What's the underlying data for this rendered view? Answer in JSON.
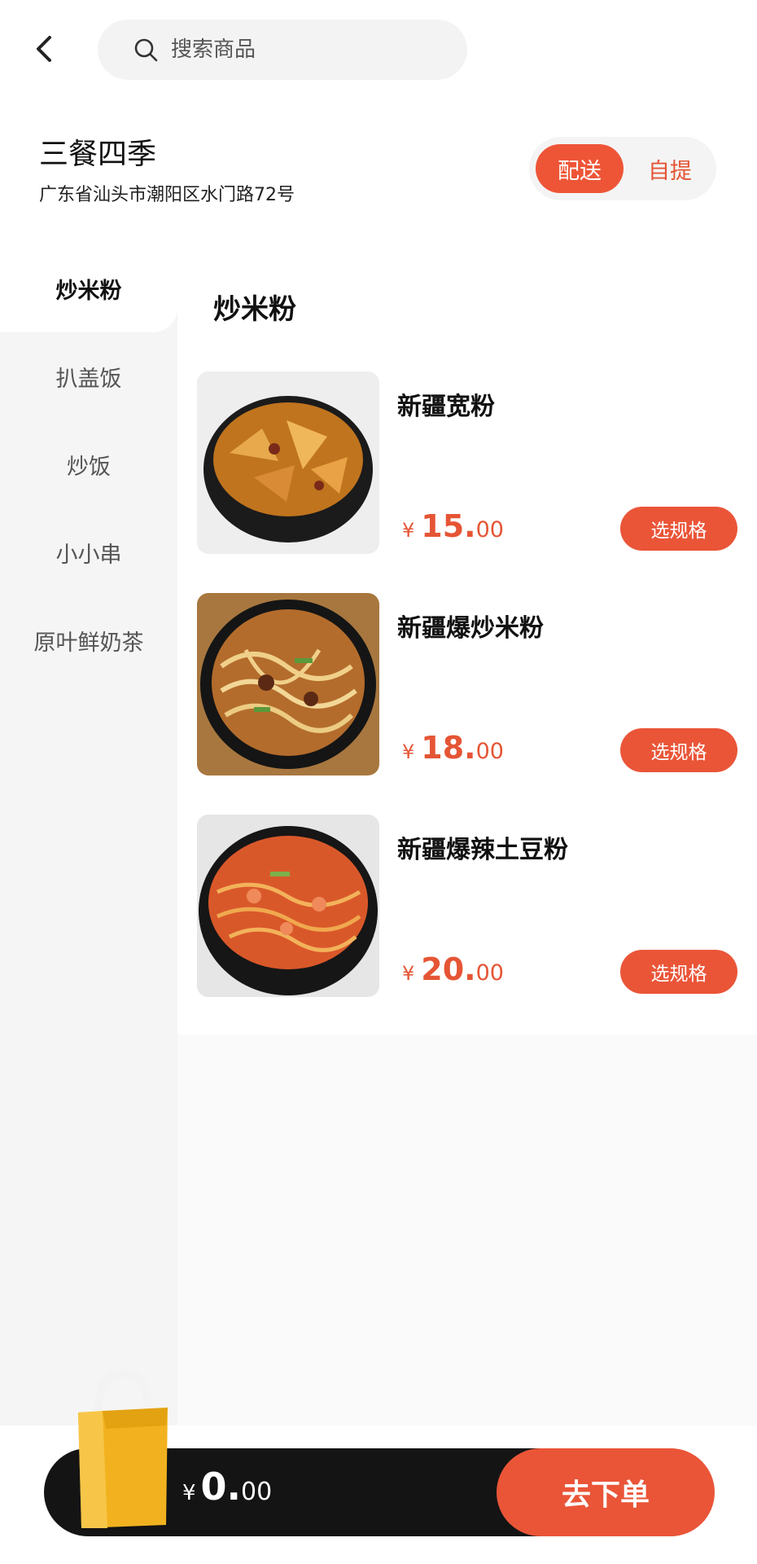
{
  "search": {
    "placeholder": "搜索商品"
  },
  "store": {
    "name": "三餐四季",
    "address": "广东省汕头市潮阳区水门路72号"
  },
  "delivery_toggle": {
    "options": [
      "配送",
      "自提"
    ],
    "selected": "配送"
  },
  "sidebar": {
    "categories": [
      {
        "label": "炒米粉",
        "active": true
      },
      {
        "label": "扒盖饭",
        "active": false
      },
      {
        "label": "炒饭",
        "active": false
      },
      {
        "label": "小小串",
        "active": false
      },
      {
        "label": "原叶鲜奶茶",
        "active": false
      }
    ]
  },
  "section": {
    "title": "炒米粉"
  },
  "products": [
    {
      "name": "新疆宽粉",
      "currency": "¥",
      "price_int": "15.",
      "price_dec": "00",
      "button": "选规格"
    },
    {
      "name": "新疆爆炒米粉",
      "currency": "¥",
      "price_int": "18.",
      "price_dec": "00",
      "button": "选规格"
    },
    {
      "name": "新疆爆辣土豆粉",
      "currency": "¥",
      "price_int": "20.",
      "price_dec": "00",
      "button": "选规格"
    }
  ],
  "cart": {
    "currency": "¥",
    "total_int": "0.",
    "total_dec": "00",
    "checkout_label": "去下单"
  },
  "colors": {
    "accent": "#ea5538",
    "bar": "#141414",
    "sidebar_bg": "#f5f5f5"
  }
}
